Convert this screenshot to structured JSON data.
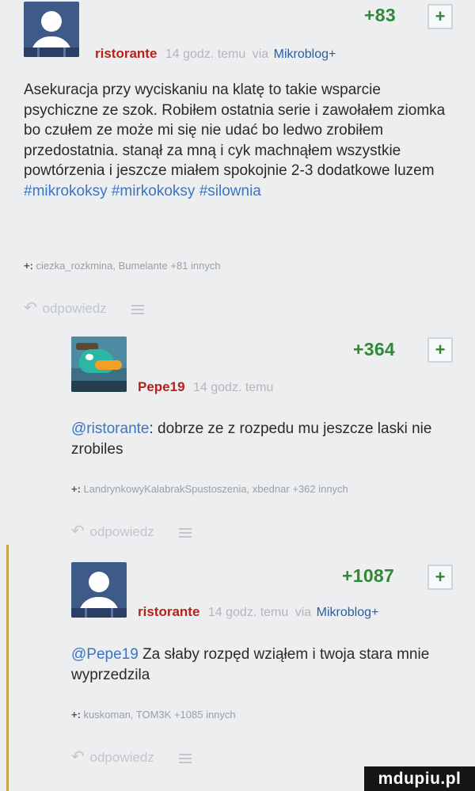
{
  "entries": [
    {
      "score": "+83",
      "plus_label": "+",
      "user": "ristorante",
      "time": "14 godz. temu",
      "via_label": "via",
      "source": "Mikroblog+",
      "body": "Asekuracja przy wyciskaniu na klatę to takie wsparcie psychiczne ze szok. Robiłem ostatnia serie i zawołałem ziomka bo czułem ze może mi się nie udać bo ledwo zrobiłem przedostatnia. stanął za mną i cyk machnąłem wszystkie powtórzenia i jeszcze miałem spokojnie 2-3 dodatkowe luzem",
      "tags": [
        "#mikrokoksy",
        "#mirkokoksy",
        "#silownia"
      ],
      "voters_prefix": "+:",
      "voters": "ciezka_rozkmina, Bumelante +81 innych",
      "reply": "odpowiedz",
      "avatar_icon": "default-user-avatar"
    },
    {
      "score": "+364",
      "plus_label": "+",
      "user": "Pepe19",
      "time": "14 godz. temu",
      "mention": "@ristorante",
      "body": ": dobrze ze z rozpedu mu jeszcze laski nie zrobiles",
      "voters_prefix": "+:",
      "voters": "LandrynkowyKalabrakSpustoszenia, xbednar +362 innych",
      "reply": "odpowiedz",
      "avatar_icon": "perry-platypus-avatar"
    },
    {
      "score": "+1087",
      "plus_label": "+",
      "user": "ristorante",
      "time": "14 godz. temu",
      "via_label": "via",
      "source": "Mikroblog+",
      "mention": "@Pepe19",
      "body": " Za słaby rozpęd wziąłem i twoja stara mnie wyprzedzila",
      "voters_prefix": "+:",
      "voters": "kuskoman, TOM3K +1085 innych",
      "reply": "odpowiedz",
      "avatar_icon": "default-user-avatar"
    }
  ],
  "watermark": "mdupiu.pl",
  "colors": {
    "score_green": "#2e8a36",
    "username_red": "#b5221b",
    "link_blue": "#3b74c2",
    "highlight_bar": "#c9a44b"
  }
}
